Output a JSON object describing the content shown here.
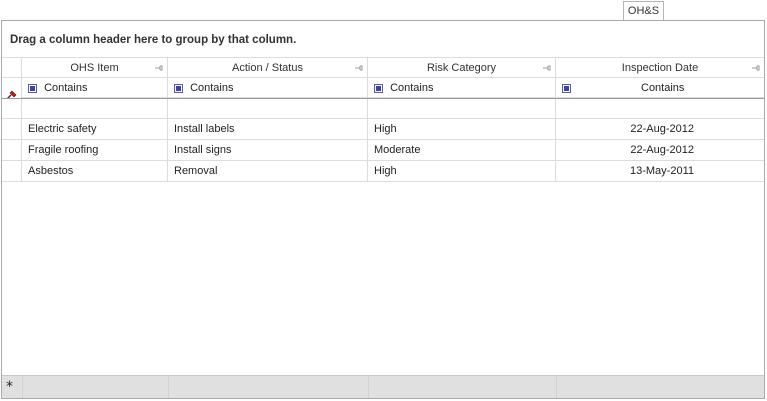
{
  "tab": {
    "label": "OH&S"
  },
  "group_panel": {
    "text": "Drag a column header here to group by that column."
  },
  "columns": [
    {
      "label": "OHS Item",
      "filter": "Contains"
    },
    {
      "label": "Action / Status",
      "filter": "Contains"
    },
    {
      "label": "Risk Category",
      "filter": "Contains"
    },
    {
      "label": "Inspection Date",
      "filter": "Contains"
    }
  ],
  "rows": [
    {
      "item": "Electric safety",
      "action": "Install labels",
      "risk": "High",
      "date": "22-Aug-2012"
    },
    {
      "item": "Fragile roofing",
      "action": "Install signs",
      "risk": "Moderate",
      "date": "22-Aug-2012"
    },
    {
      "item": "Asbestos",
      "action": "Removal",
      "risk": "High",
      "date": "13-May-2011"
    }
  ],
  "footer": {
    "new_row_symbol": "*"
  },
  "icons": {
    "filter_row_indicator": "pin-icon",
    "new_row": "asterisk-icon"
  }
}
